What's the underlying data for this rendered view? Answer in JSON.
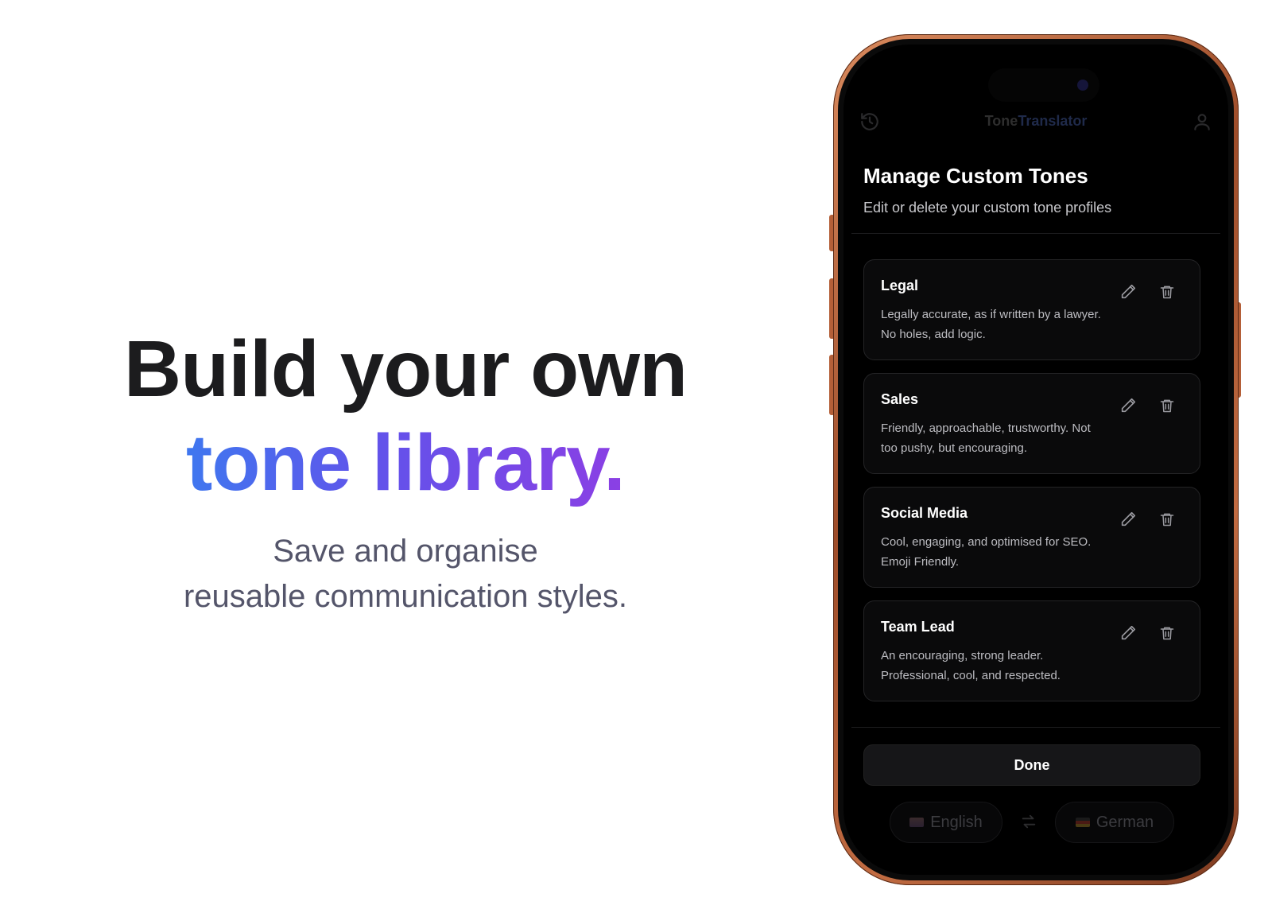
{
  "hero": {
    "line1": "Build your own",
    "line2": "tone library.",
    "subtitle_line1": "Save and organise",
    "subtitle_line2": "reusable communication styles."
  },
  "app": {
    "title_part1": "Tone",
    "title_part2": "Translator"
  },
  "sheet": {
    "title": "Manage Custom Tones",
    "subtitle": "Edit or delete your custom tone profiles",
    "done_label": "Done"
  },
  "tones": [
    {
      "name": "Legal",
      "description": "Legally accurate, as if written by a lawyer. No holes, add logic."
    },
    {
      "name": "Sales",
      "description": "Friendly, approachable, trustworthy. Not too pushy, but encouraging."
    },
    {
      "name": "Social Media",
      "description": "Cool, engaging, and optimised for SEO. Emoji Friendly."
    },
    {
      "name": "Team Lead",
      "description": "An encouraging, strong leader. Professional, cool, and respected."
    }
  ],
  "languages": {
    "source": "English",
    "target": "German"
  },
  "colors": {
    "gradient_start": "#3f77ef",
    "gradient_end": "#8b3fe4",
    "frame": "#b45f38"
  }
}
